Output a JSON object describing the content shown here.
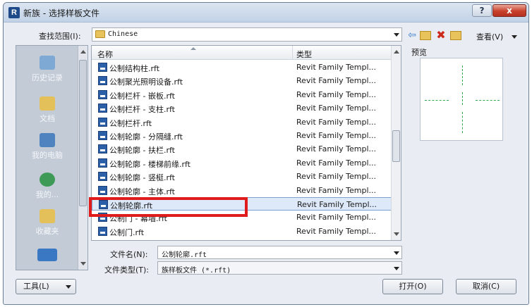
{
  "window": {
    "title": "新族 - 选择样板文件",
    "help_label": "?",
    "close_label": "x"
  },
  "lookin": {
    "label": "查找范围(I):",
    "value": "Chinese"
  },
  "toolbar": {
    "view_label": "查看(V)"
  },
  "places": [
    {
      "label": "历史记录",
      "icon": "history-icon"
    },
    {
      "label": "文档",
      "icon": "documents-icon"
    },
    {
      "label": "我的电脑",
      "icon": "computer-icon"
    },
    {
      "label": "我的...",
      "icon": "network-icon"
    },
    {
      "label": "收藏夹",
      "icon": "favorites-icon"
    },
    {
      "label": "",
      "icon": "desktop-icon"
    }
  ],
  "file_list": {
    "columns": {
      "name": "名称",
      "type": "类型"
    },
    "rows": [
      {
        "name": "公制结构柱.rft",
        "type": "Revit Family Templ..."
      },
      {
        "name": "公制聚光照明设备.rft",
        "type": "Revit Family Templ..."
      },
      {
        "name": "公制栏杆 - 嵌板.rft",
        "type": "Revit Family Templ..."
      },
      {
        "name": "公制栏杆 - 支柱.rft",
        "type": "Revit Family Templ..."
      },
      {
        "name": "公制栏杆.rft",
        "type": "Revit Family Templ..."
      },
      {
        "name": "公制轮廓 - 分隔缝.rft",
        "type": "Revit Family Templ..."
      },
      {
        "name": "公制轮廓 - 扶栏.rft",
        "type": "Revit Family Templ..."
      },
      {
        "name": "公制轮廓 - 楼梯前缘.rft",
        "type": "Revit Family Templ..."
      },
      {
        "name": "公制轮廓 - 竖梃.rft",
        "type": "Revit Family Templ..."
      },
      {
        "name": "公制轮廓 - 主体.rft",
        "type": "Revit Family Templ..."
      },
      {
        "name": "公制轮廓.rft",
        "type": "Revit Family Templ...",
        "selected": true
      },
      {
        "name": "公制门 - 幕墙.rft",
        "type": "Revit Family Templ..."
      },
      {
        "name": "公制门.rft",
        "type": "Revit Family Templ..."
      }
    ]
  },
  "preview": {
    "label": "预览"
  },
  "filename": {
    "label": "文件名(N):",
    "value": "公制轮廓.rft"
  },
  "filetype": {
    "label": "文件类型(T):",
    "value": "族样板文件 (*.rft)"
  },
  "buttons": {
    "tools": "工具(L)",
    "open": "打开(O)",
    "cancel": "取消(C)"
  },
  "colors": {
    "selection": "#dde9f8",
    "highlight": "#e01b1b",
    "preview_lines": "#2fa84a"
  }
}
